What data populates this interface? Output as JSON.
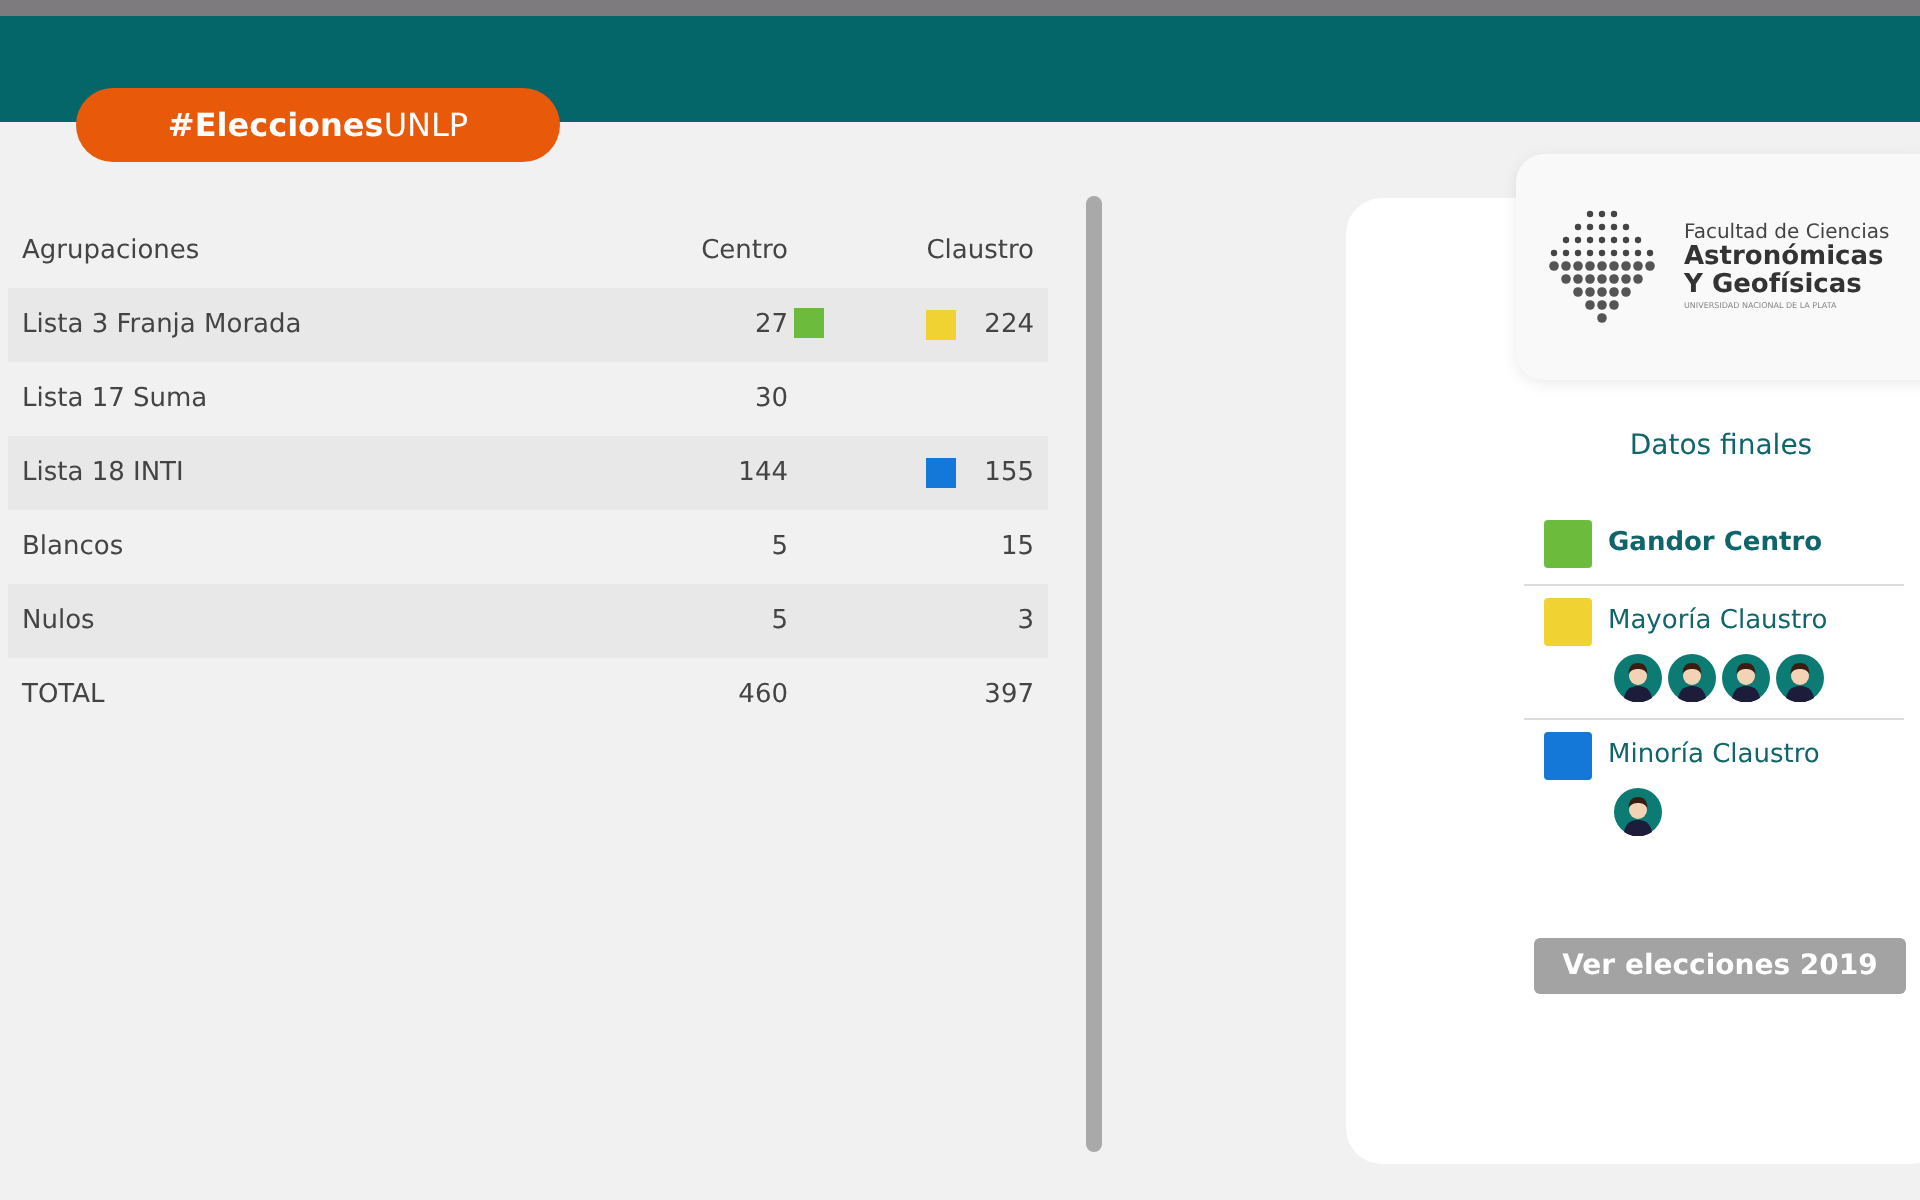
{
  "hashtag": "**#Elecciones**UNLP",
  "table": {
    "columns": [
      "Agrupaciones",
      "Centro",
      "Claustro"
    ],
    "rows": [
      {
        "name": "Lista 3 Franja Morada",
        "centro": "27",
        "claustro": "224",
        "centro_marker": {
          "color": "#6cbb3c"
        },
        "claustro_marker": {
          "color": "#f0d233"
        }
      },
      {
        "name": "Lista 17 Suma",
        "centro": "30"
      },
      {
        "name": "Lista 18 INTI",
        "centro": "144",
        "claustro": "155",
        "claustro_marker": {
          "color": "#1478d8"
        }
      },
      {
        "name": "Blancos",
        "centro": "5",
        "claustro": "15"
      },
      {
        "name": "Nulos",
        "centro": "5",
        "claustro": "3"
      },
      {
        "name": "TOTAL",
        "centro": "460",
        "claustro": "397"
      }
    ]
  },
  "logo": {
    "line_1": "Facultad de Ciencias",
    "line_2": "Astronómicas",
    "line_3": "Y Geofísicas",
    "line_4": "UNIVERSIDAD NACIONAL DE LA PLATA"
  },
  "results": {
    "title": "Datos finales",
    "items": [
      {
        "label": "Gandor Centro",
        "color": "#6cbb3c",
        "emphasized": true
      },
      {
        "label": "Mayoría Claustro",
        "color": "#f0d233",
        "emphasized": false,
        "seats": [
          {
            "kind": "avatar"
          },
          {
            "kind": "avatar"
          },
          {
            "kind": "avatar"
          },
          {
            "kind": "avatar"
          }
        ]
      },
      {
        "label": "Minoría Claustro",
        "color": "#1478d8",
        "emphasized": false,
        "seats": [
          {
            "kind": "avatar"
          }
        ]
      }
    ]
  },
  "button": "Ver elecciones 2019"
}
